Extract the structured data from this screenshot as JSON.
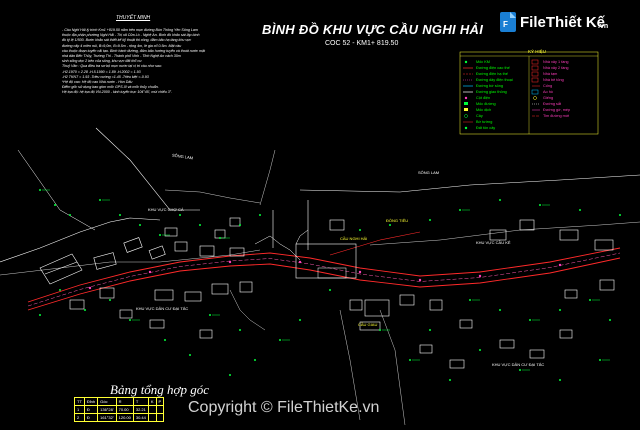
{
  "drawing": {
    "title": "BÌNH ĐỒ KHU VỰC CẦU NGHI HẢI",
    "subtitle": "COC 52 - KM1+ 819.50"
  },
  "notes": {
    "title": "THUYẾT MINH",
    "lines": [
      "- Cầu Nghi Hải lý trình Km1 +819.50 nằm trên mực đường Bùn Thông Yên Sông Lam",
      "thuộc địa phận phường Nghi Hải - Thị xã Cửa Lò - Nghệ An. Bình đồ khảo sát lập bình",
      "đồ tỷ lệ 1/500. Bước khảo sát thiết kế kỹ thuật thi công, đảm bảo hạ tầng khu vực",
      "đường cấp 4 miền núi, B=9,0m, B=9.5m - rộng 4m, lề gia cố 0.5m. Mặt cầu",
      "cầu thuộc đoạn tuyến cải tạo. Bình hành đường, đảm bảo hướng tuyến và thoát nước mặt",
      "nhà dân Bến Thủy, Trường Thi - Thành phố Vinh - Tỉnh Nghệ An cách 30m",
      "sinh sống dọc 2 bên của sông, khu vực đất thổ cư.",
      "Thuỷ Văn : Qua điều tra sơ bộ mực nước tại vị trí cầu như sau:",
      "-H2.1970 = 2.28   -H.5.1990 = 1.89   -H.2002 = 1.93",
      "-H2 TKNT = 1.93   -Triều cường =1.45   -Triều kiệt =-0.93",
      "*Hệ độ cao: Hệ độ cao Nhà nước - Hòn Dấu",
      "Điểm gốc sử dụng bao gồm mốc GPS III và mốc thủy chuẩn.",
      "Hệ tọa độ: hệ tọa độ VN-2000 - kinh tuyến trục 104°45', múi chiếu 3°."
    ]
  },
  "legend": {
    "title": "KÝ HIỆU",
    "items": [
      {
        "symbol": "Mốc KM",
        "desc": "Nhà xây 1 tầng"
      },
      {
        "symbol": "Đường điện cao thế",
        "desc": "Nhà xây 2 tầng"
      },
      {
        "symbol": "Đường điện hạ thế",
        "desc": "Nhà tạm"
      },
      {
        "symbol": "Đường dây điện thoại",
        "desc": "Nhà bê tông"
      },
      {
        "symbol": "Đường bờ sông",
        "desc": "Cống"
      },
      {
        "symbol": "Đường giao thông",
        "desc": "Ao hồ"
      },
      {
        "symbol": "Cột điện",
        "desc": "Giếng"
      },
      {
        "symbol": "Mốc đường",
        "desc": "Đường sắt"
      },
      {
        "symbol": "Mốc dịch",
        "desc": "Đường gờ, mép"
      },
      {
        "symbol": "Cây",
        "desc": "Tim đường mới"
      },
      {
        "symbol": "Bờ tường",
        "desc": ""
      },
      {
        "symbol": "Đất tôn cây",
        "desc": ""
      }
    ]
  },
  "map_labels": {
    "song_lam_left": "SÔNG LAM",
    "song_lam_right": "SÔNG LAM",
    "chom_da": "KHU VỰC CHỢ CÁ",
    "cau_nghi_hai": "CẦU NGHI HẢI",
    "dan_cu_left": "KHU VỰC DÂN CƯ ĐẠI TẮC",
    "dan_cu_right": "KHU VỰC DÂN CƯ ĐẠI TẮC",
    "cau_ke": "KHU VỰC CẦU KÊ",
    "cau_giau": "CẦU GIAU",
    "dung_tieu": "ĐÒNG TIÊU"
  },
  "table": {
    "title": "Bảng tổng hợp góc",
    "headers": [
      "TT",
      "Đỉnh",
      "Góc",
      "R",
      "T",
      "K",
      "P"
    ],
    "rows": [
      [
        "1",
        "Đ",
        "136°28'",
        "70.00",
        "32.21",
        "",
        ""
      ],
      [
        "2",
        "Đ",
        "161°32'",
        "120.00",
        "30.44",
        "",
        ""
      ]
    ]
  },
  "watermark": {
    "logo_text": "FileThiết Kế",
    "logo_tld": ".vn",
    "copyright": "Copyright © FileThietKe.vn"
  },
  "colors": {
    "background": "#000000",
    "road": "#ff2a2a",
    "road_center": "#ff5ab0",
    "contour": "#ffffff",
    "points": "#00ff3a",
    "labels": "#ffff33",
    "water": "#00c0ff"
  }
}
